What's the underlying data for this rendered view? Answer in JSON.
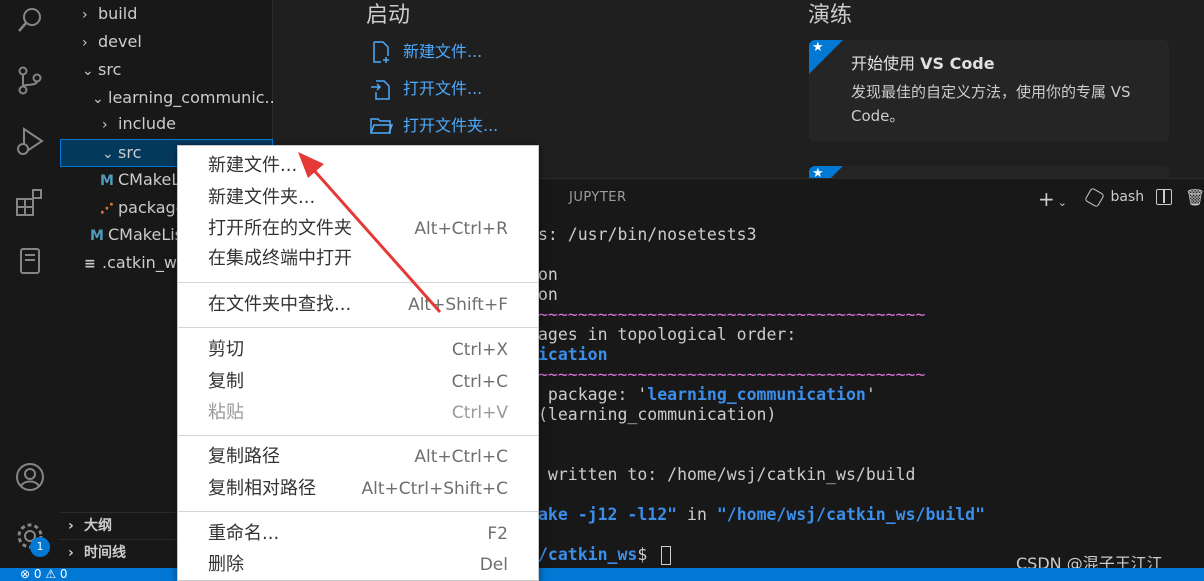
{
  "sidebar": {
    "tree": [
      {
        "label": "build",
        "chevron": "›"
      },
      {
        "label": "devel",
        "chevron": "›"
      },
      {
        "label": "src",
        "chevron": "⌄"
      },
      {
        "label": "learning_communic...",
        "chevron": "⌄"
      },
      {
        "label": "include",
        "chevron": "›"
      },
      {
        "label": "src",
        "chevron": "⌄"
      },
      {
        "label": "CMakeL",
        "icon": "M"
      },
      {
        "label": "package",
        "icon": "rss-icon"
      },
      {
        "label": "CMakeLis",
        "icon": "M"
      },
      {
        "label": ".catkin_wo",
        "icon": "≡"
      }
    ],
    "sections": [
      {
        "label": "大纲"
      },
      {
        "label": "时间线"
      }
    ],
    "settings_badge": "1"
  },
  "welcome": {
    "start_heading": "启动",
    "start_links": [
      "新建文件...",
      "打开文件...",
      "打开文件夹..."
    ],
    "walkthrough_heading": "演练",
    "card_title_prefix": "开始使用 ",
    "card_title_bold": "VS Code",
    "card_desc": "发现最佳的自定义方法，使用你的专属 VS Code。"
  },
  "panel": {
    "tab_label": "JUPYTER",
    "shell_label": "bash",
    "terminal_lines": [
      {
        "parts": [
          {
            "t": "s: /usr/bin/nosetests3"
          }
        ]
      },
      {
        "parts": [
          {
            "t": ""
          }
        ]
      },
      {
        "parts": [
          {
            "t": "on"
          }
        ]
      },
      {
        "parts": [
          {
            "t": "on"
          }
        ]
      },
      {
        "parts": [
          {
            "t": "~~~~~~~~~~~~~~~~~~~~~~~~~~~~~~~~~~~~~~~",
            "c": "pink"
          }
        ]
      },
      {
        "parts": [
          {
            "t": "ages in topological order:"
          }
        ]
      },
      {
        "parts": [
          {
            "t": "ication",
            "c": "blue"
          }
        ]
      },
      {
        "parts": [
          {
            "t": "~~~~~~~~~~~~~~~~~~~~~~~~~~~~~~~~~~~~~~~",
            "c": "pink"
          }
        ]
      },
      {
        "parts": [
          {
            "t": " package: '"
          },
          {
            "t": "learning_communication",
            "c": "blue"
          },
          {
            "t": "'"
          }
        ]
      },
      {
        "parts": [
          {
            "t": "(learning_communication)"
          }
        ]
      },
      {
        "parts": [
          {
            "t": ""
          }
        ]
      },
      {
        "parts": [
          {
            "t": ""
          }
        ]
      },
      {
        "parts": [
          {
            "t": " written to: /home/wsj/catkin_ws/build"
          }
        ]
      },
      {
        "parts": [
          {
            "t": ""
          }
        ]
      },
      {
        "parts": [
          {
            "t": "ake -j12 -l12\"",
            "c": "blue"
          },
          {
            "t": " in "
          },
          {
            "t": "\"/home/wsj/catkin_ws/build\"",
            "c": "blue"
          }
        ]
      },
      {
        "parts": [
          {
            "t": ""
          }
        ]
      },
      {
        "parts": [
          {
            "t": "/catkin_ws",
            "c": "blue"
          },
          {
            "t": "$ "
          }
        ]
      }
    ]
  },
  "context_menu": {
    "items": [
      {
        "label": "新建文件...",
        "shortcut": ""
      },
      {
        "label": "新建文件夹...",
        "shortcut": ""
      },
      {
        "label": "打开所在的文件夹",
        "shortcut": "Alt+Ctrl+R"
      },
      {
        "label": "在集成终端中打开",
        "shortcut": ""
      },
      {
        "label": "在文件夹中查找...",
        "shortcut": "Alt+Shift+F"
      },
      {
        "label": "剪切",
        "shortcut": "Ctrl+X"
      },
      {
        "label": "复制",
        "shortcut": "Ctrl+C"
      },
      {
        "label": "粘贴",
        "shortcut": "Ctrl+V",
        "disabled": true
      },
      {
        "label": "复制路径",
        "shortcut": "Alt+Ctrl+C"
      },
      {
        "label": "复制相对路径",
        "shortcut": "Alt+Ctrl+Shift+C"
      },
      {
        "label": "重命名...",
        "shortcut": "F2"
      },
      {
        "label": "删除",
        "shortcut": "Del"
      }
    ]
  },
  "statusbar": {
    "text": "⊗ 0 ⚠ 0"
  },
  "watermark": "CSDN @混子王江江",
  "colors": {
    "accent": "#0078d4",
    "link": "#4daafc",
    "annotation_arrow": "#e53935"
  }
}
